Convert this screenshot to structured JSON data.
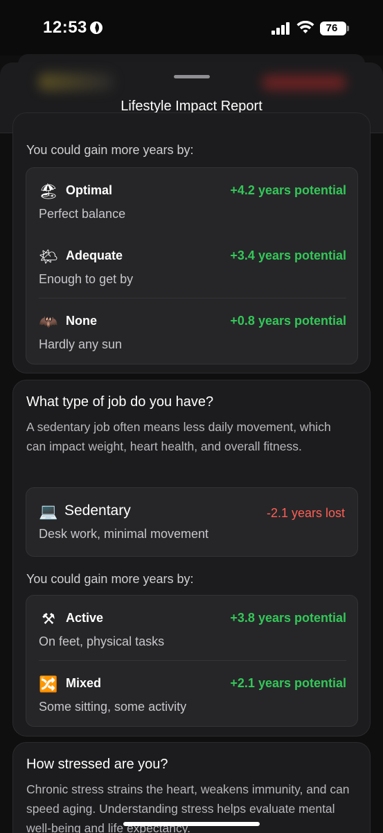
{
  "status_bar": {
    "time": "12:53",
    "battery": "76"
  },
  "modal": {
    "title": "Lifestyle Impact Report"
  },
  "sun_section": {
    "gain_heading": "You could gain more years by:",
    "options": [
      {
        "emoji": "🏖",
        "title": "Optimal",
        "gain": "+4.2 years potential",
        "subtitle": "Perfect balance"
      },
      {
        "emoji": "🌤",
        "title": "Adequate",
        "gain": "+3.4 years potential",
        "subtitle": "Enough to get by"
      },
      {
        "emoji": "🦇",
        "title": "None",
        "gain": "+0.8 years potential",
        "subtitle": "Hardly any sun"
      }
    ]
  },
  "job_section": {
    "question": "What type of job do you have?",
    "description": "A sedentary job often means less daily movement, which can impact weight, heart health, and overall fitness.",
    "current": {
      "emoji": "💻",
      "title": "Sedentary",
      "loss": "-2.1 years lost",
      "subtitle": "Desk work, minimal movement"
    },
    "gain_heading": "You could gain more years by:",
    "options": [
      {
        "emoji": "⚒",
        "title": "Active",
        "gain": "+3.8 years potential",
        "subtitle": "On feet, physical tasks"
      },
      {
        "emoji": "🔀",
        "title": "Mixed",
        "gain": "+2.1 years potential",
        "subtitle": "Some sitting, some activity"
      }
    ]
  },
  "stress_section": {
    "question": "How stressed are you?",
    "description": "Chronic stress strains the heart, weakens immunity, and can speed aging. Understanding stress helps evaluate mental well-being and life expectancy."
  },
  "colors": {
    "gain": "#34c759",
    "loss": "#ff5f57",
    "card": "#1c1c1e"
  }
}
